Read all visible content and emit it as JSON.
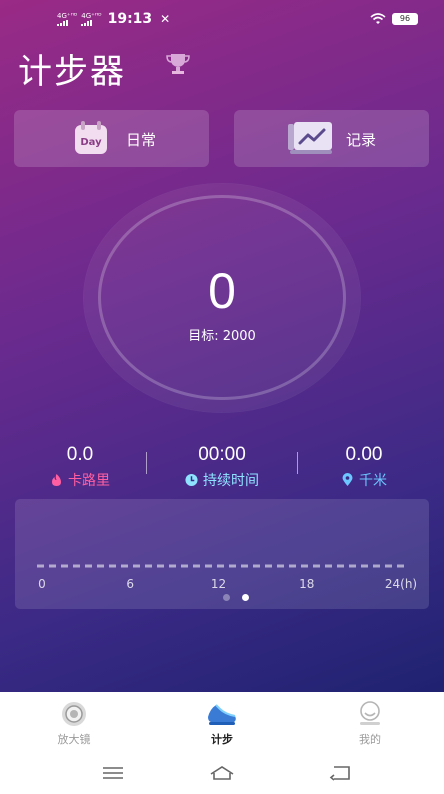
{
  "status_bar": {
    "sim1": "4G⁺ᴴᴰ",
    "sim2": "4G⁺ᴴᴰ",
    "time": "19:13",
    "battery": "96",
    "icons": [
      "signal-icon",
      "tools-icon",
      "wifi-icon",
      "battery-icon"
    ]
  },
  "header": {
    "title": "计步器",
    "trophy_icon": "trophy-icon"
  },
  "buttons": {
    "daily": {
      "label": "日常",
      "icon_text": "Day",
      "icon": "calendar-day-icon"
    },
    "record": {
      "label": "记录",
      "icon": "trend-chart-icon"
    }
  },
  "ring": {
    "steps": "0",
    "goal": "目标: 2000"
  },
  "stats": [
    {
      "value": "0.0",
      "label": "卡路里",
      "icon": "flame-icon",
      "color": "#ff5fa2"
    },
    {
      "value": "00:00",
      "label": "持续时间",
      "icon": "clock-icon",
      "color": "#8fe3ff"
    },
    {
      "value": "0.00",
      "label": "千米",
      "icon": "location-pin-icon",
      "color": "#6cc6ff"
    }
  ],
  "chart_data": {
    "type": "bar",
    "x_ticks": [
      "0",
      "6",
      "12",
      "18",
      "24(h)"
    ],
    "xlim": [
      0,
      24
    ],
    "values": [
      0,
      0,
      0,
      0,
      0,
      0,
      0,
      0,
      0,
      0,
      0,
      0,
      0,
      0,
      0,
      0,
      0,
      0,
      0,
      0,
      0,
      0,
      0,
      0
    ],
    "title": "",
    "xlabel": "",
    "ylabel": "",
    "grid": false
  },
  "pager": {
    "pages": 2,
    "active": 1
  },
  "tabbar": {
    "items": [
      {
        "label": "放大镜",
        "icon": "magnifier-icon",
        "active": false
      },
      {
        "label": "计步",
        "icon": "shoe-icon",
        "active": true
      },
      {
        "label": "我的",
        "icon": "user-icon",
        "active": false
      }
    ]
  },
  "navbar": [
    "menu-icon",
    "home-icon",
    "back-icon"
  ]
}
